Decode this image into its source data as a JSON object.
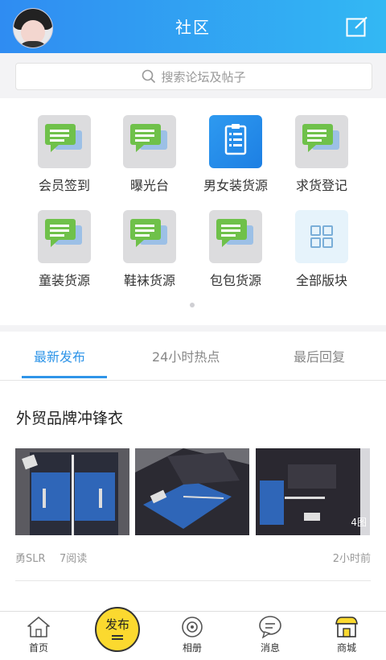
{
  "header": {
    "title": "社区"
  },
  "search": {
    "placeholder": "搜索论坛及帖子"
  },
  "categories": [
    {
      "label": "会员签到",
      "icon": "chat-bubbles-icon"
    },
    {
      "label": "曝光台",
      "icon": "chat-bubbles-icon"
    },
    {
      "label": "男女装货源",
      "icon": "clipboard-list-icon"
    },
    {
      "label": "求货登记",
      "icon": "chat-bubbles-icon"
    },
    {
      "label": "童装货源",
      "icon": "chat-bubbles-icon"
    },
    {
      "label": "鞋袜货源",
      "icon": "chat-bubbles-icon"
    },
    {
      "label": "包包货源",
      "icon": "chat-bubbles-icon"
    },
    {
      "label": "全部版块",
      "icon": "grid-icon"
    }
  ],
  "tabs": [
    {
      "label": "最新发布",
      "active": true
    },
    {
      "label": "24小时热点",
      "active": false
    },
    {
      "label": "最后回复",
      "active": false
    }
  ],
  "post": {
    "title": "外贸品牌冲锋衣",
    "image_badge": "4图",
    "author": "勇SLR",
    "reads": "7阅读",
    "time": "2小时前"
  },
  "bottom_nav": [
    {
      "label": "首页",
      "icon": "home-icon"
    },
    {
      "label": "发布",
      "icon": "publish-icon"
    },
    {
      "label": "相册",
      "icon": "album-icon"
    },
    {
      "label": "消息",
      "icon": "message-icon"
    },
    {
      "label": "商城",
      "icon": "shop-icon"
    }
  ],
  "colors": {
    "accent": "#2f95e8",
    "header_start": "#2f8cf2",
    "header_end": "#33b8f3",
    "publish": "#fbd92f"
  }
}
